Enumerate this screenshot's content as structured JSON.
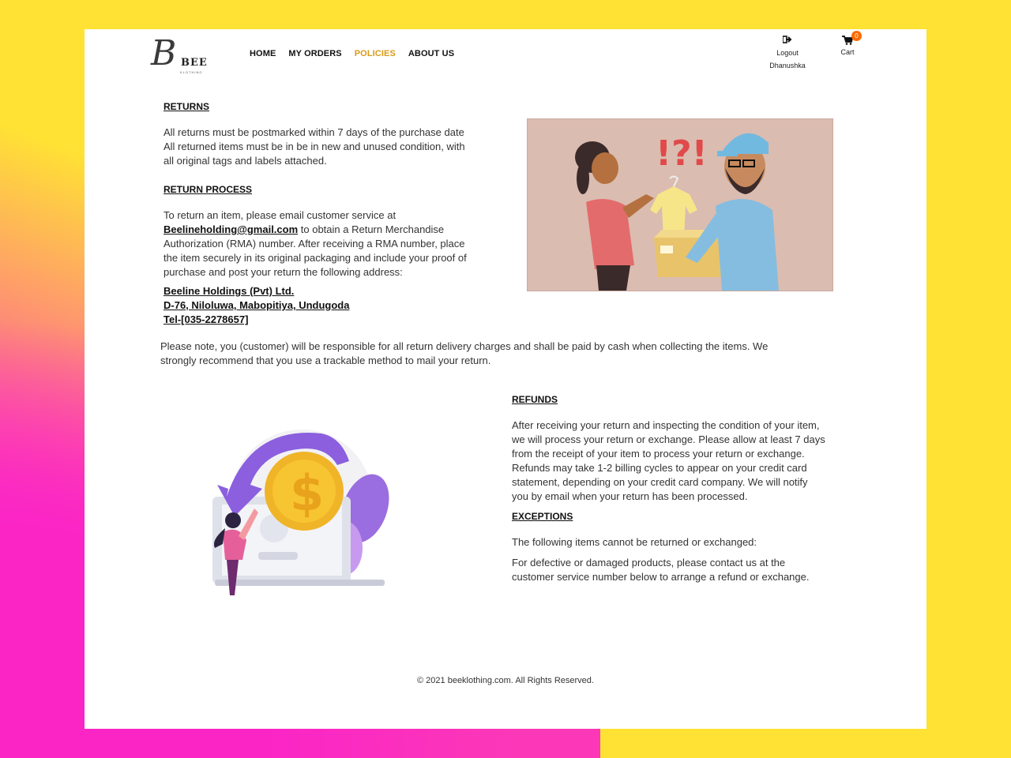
{
  "brand": {
    "logo_letter": "B",
    "logo_name": "BEE",
    "logo_sub": "KLOTHING"
  },
  "nav": {
    "home": "HOME",
    "orders": "MY ORDERS",
    "policies": "POLICIES",
    "about": "ABOUT US"
  },
  "account": {
    "logout": "Logout",
    "user": "Dhanushka",
    "cart": "Cart",
    "cart_count": "0"
  },
  "returns": {
    "heading": "RETURNS",
    "line1": "All returns must be postmarked within 7 days of the purchase date",
    "line2": "All returned items must be in be in new and unused condition, with",
    "line3": "all original tags and labels attached."
  },
  "return_process": {
    "heading": "RETURN PROCESS",
    "l1": "To return an item, please email customer service at",
    "email": "Beelineholding@gmail.com",
    "l2": " to obtain a Return Merchandise",
    "l3": "Authorization (RMA) number. After receiving a RMA number, place",
    "l4": "the item securely in its original packaging and include your proof of",
    "l5": "purchase and post your return the following address:",
    "addr1": "Beeline Holdings (Pvt) Ltd.",
    "addr2": "D-76, Niloluwa, Mabopitiya, Undugoda",
    "addr3": "Tel-[035-2278657]"
  },
  "note": {
    "l1": "Please note, you (customer) will be responsible for all return delivery charges and shall be paid by cash when collecting the items. We",
    "l2": "strongly recommend that you use a trackable method to mail your return."
  },
  "refunds": {
    "heading": "REFUNDS",
    "l1": "After receiving your return and inspecting the condition of your item,",
    "l2": "we will process your return or exchange. Please allow at least 7 days",
    "l3": "from the receipt of your item to process your return or exchange.",
    "l4": "Refunds may take 1-2 billing cycles to appear on your credit card",
    "l5": "statement, depending on your credit card company. We will notify",
    "l6": "you by email when your return has been processed."
  },
  "exceptions": {
    "heading": "EXCEPTIONS",
    "l1": "The following items cannot be returned or exchanged:",
    "l2": "For defective or damaged products, please contact us at the",
    "l3": "customer service number below to arrange a refund or exchange."
  },
  "footer": {
    "text": "© 2021 beeklothing.com. All Rights Reserved."
  },
  "colors": {
    "active_nav": "#d89a1a",
    "cart_badge": "#ff6a00",
    "bg_yellow": "#ffe234",
    "bg_pink": "#fb25c6"
  }
}
